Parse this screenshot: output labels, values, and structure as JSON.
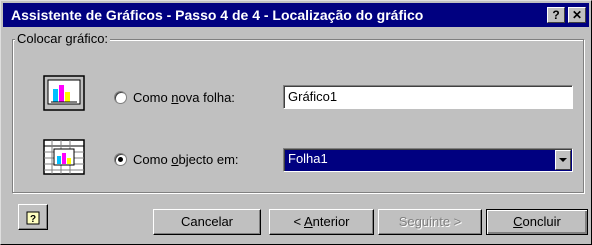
{
  "window": {
    "title": "Assistente de Gráficos - Passo 4 de 4 - Localização do gráfico",
    "help_button": "?",
    "close_button": "✕"
  },
  "placement": {
    "group_label": "Colocar gráfico:",
    "new_sheet": {
      "label_pre": "Como ",
      "label_accel": "n",
      "label_post": "ova folha:",
      "value": "Gráfico1",
      "selected": false
    },
    "as_object": {
      "label_pre": "Como ",
      "label_accel": "o",
      "label_post": "bjecto em:",
      "value": "Folha1",
      "selected": true
    }
  },
  "buttons": {
    "cancel": "Cancelar",
    "back_pre": "< ",
    "back_accel": "A",
    "back_post": "nterior",
    "next": "Seguinte >",
    "finish_accel": "C",
    "finish_post": "oncluir"
  },
  "colors": {
    "titlebar": "#000080",
    "dialog": "#c0c0c0",
    "selection": "#000080"
  }
}
